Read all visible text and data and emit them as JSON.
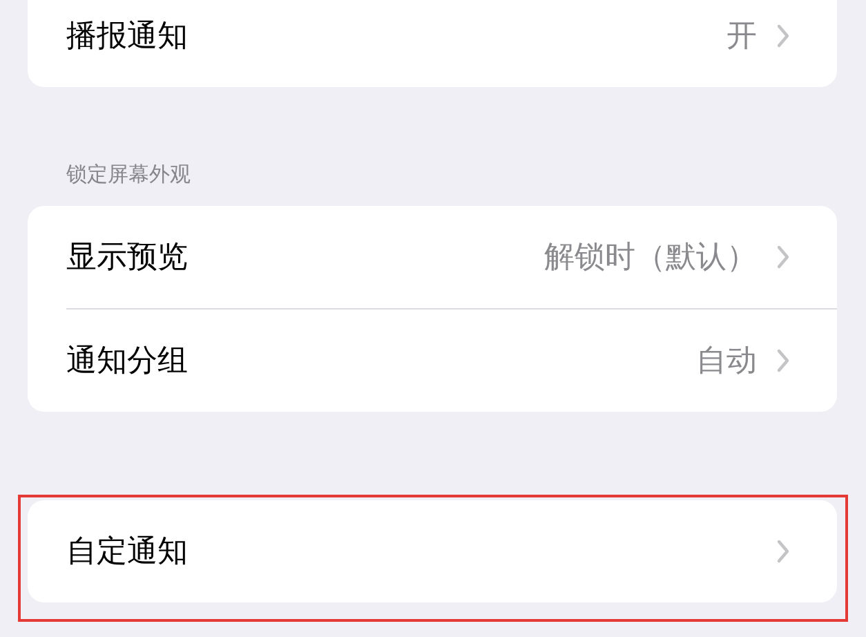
{
  "sections": [
    {
      "rows": [
        {
          "label": "播报通知",
          "value": "开"
        }
      ]
    },
    {
      "header": "锁定屏幕外观",
      "rows": [
        {
          "label": "显示预览",
          "value": "解锁时（默认）"
        },
        {
          "label": "通知分组",
          "value": "自动"
        }
      ]
    },
    {
      "highlighted": true,
      "rows": [
        {
          "label": "自定通知"
        }
      ]
    }
  ]
}
